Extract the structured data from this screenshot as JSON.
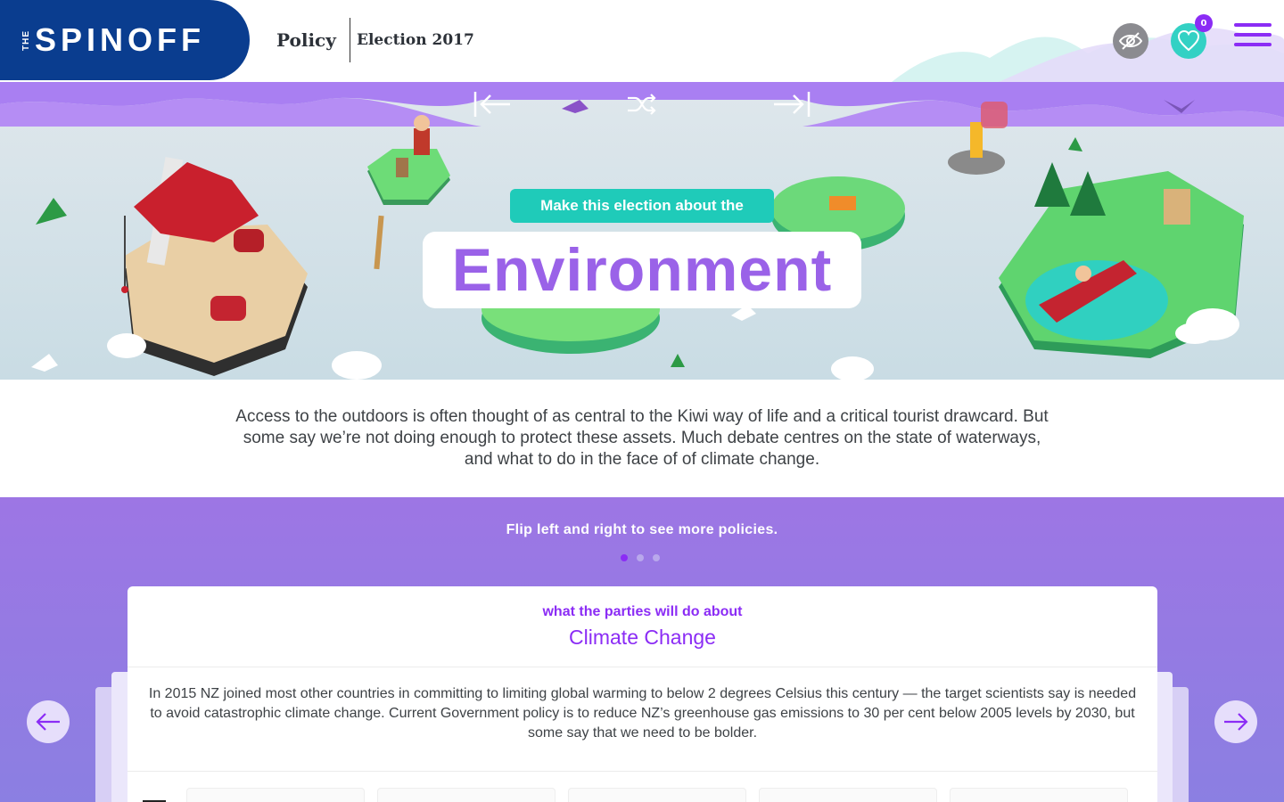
{
  "header": {
    "logo_small": "THE",
    "logo_main": "SPINOFF",
    "breadcrumb_1": "Policy",
    "breadcrumb_2": "Election 2017",
    "favorites_count": "0",
    "icons": [
      "hide-icon",
      "heart-icon",
      "menu-icon"
    ]
  },
  "hero": {
    "nav_icons": [
      "arrow-left-bar-icon",
      "shuffle-icon",
      "arrow-right-bar-icon"
    ],
    "tagline": "Make this election about the",
    "title": "Environment"
  },
  "intro": {
    "text": "Access to the outdoors is often thought of as central to the Kiwi way of life and a critical tourist drawcard. But some say we’re not doing enough to protect these assets. Much debate centres on the state of waterways, and what to do in the face of of climate change."
  },
  "policies": {
    "instruction": "Flip left and right to see more policies.",
    "page_count": 3,
    "active_page": 1,
    "card": {
      "kicker": "what the parties will do about",
      "title": "Climate Change",
      "body": "In 2015 NZ joined most other countries in committing to limiting global warming to below 2 degrees Celsius this century — the target scientists say is needed to avoid catastrophic climate change. Current Government policy is to reduce NZ’s greenhouse gas emissions to 30 per cent below 2005 levels by 2030, but some say that we need to be bolder."
    }
  },
  "colors": {
    "brand_blue": "#0a3d8f",
    "accent_purple": "#8b2cf5",
    "title_purple": "#9a62e8",
    "teal": "#1fcbb9"
  }
}
